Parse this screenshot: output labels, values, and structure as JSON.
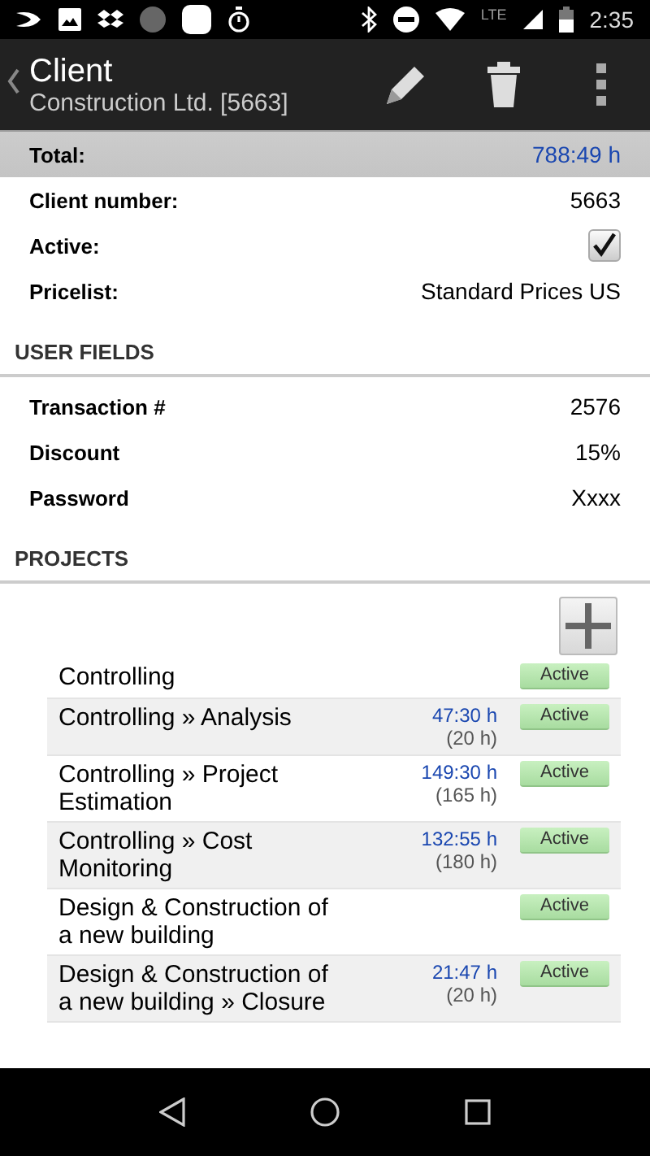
{
  "status_bar": {
    "network": "LTE",
    "time": "2:35"
  },
  "app_bar": {
    "title": "Client",
    "subtitle": "Construction Ltd. [5663]"
  },
  "total": {
    "label": "Total:",
    "value": "788:49 h"
  },
  "fields": [
    {
      "label": "Client number:",
      "kind": "text",
      "value": "5663"
    },
    {
      "label": "Active:",
      "kind": "checkbox",
      "checked": true
    },
    {
      "label": "Pricelist:",
      "kind": "text",
      "value": "Standard Prices US"
    }
  ],
  "user_fields": {
    "title": "USER FIELDS",
    "fields": [
      {
        "label": "Transaction #",
        "value": "2576"
      },
      {
        "label": "Discount",
        "value": "15%"
      },
      {
        "label": "Password",
        "value": "Xxxx"
      }
    ]
  },
  "projects": {
    "title": "PROJECTS",
    "items": [
      {
        "name": "Controlling",
        "status": "Active"
      },
      {
        "name": "Controlling » Analysis",
        "time": "47:30 h",
        "estimate": "(20 h)",
        "status": "Active"
      },
      {
        "name": "Controlling » Project Estimation",
        "time": "149:30 h",
        "estimate": "(165 h)",
        "status": "Active"
      },
      {
        "name": "Controlling » Cost Monitoring",
        "time": "132:55 h",
        "estimate": "(180 h)",
        "status": "Active"
      },
      {
        "name": "Design & Construction of a new building",
        "status": "Active"
      },
      {
        "name": "Design & Construction of a new building » Closure",
        "time": "21:47 h",
        "estimate": "(20 h)",
        "status": "Active"
      }
    ]
  }
}
